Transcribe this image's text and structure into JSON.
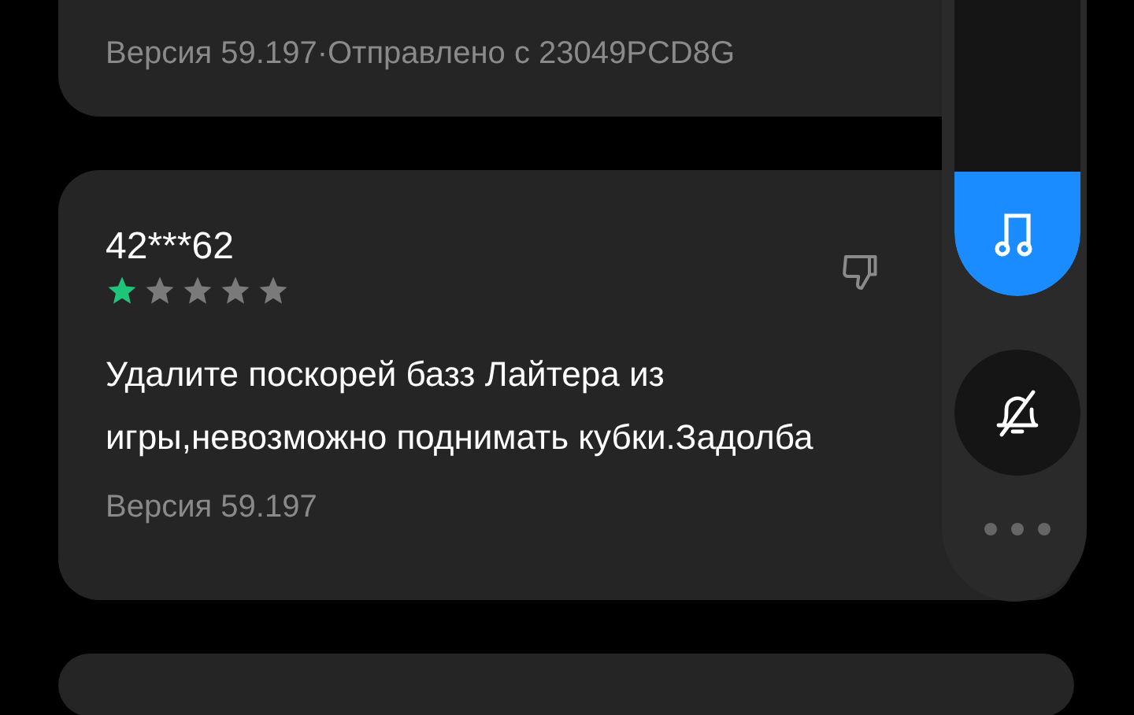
{
  "reviews": [
    {
      "kind": "meta_only",
      "meta": "Версия 59.197·Отправлено с 23049PCD8G"
    },
    {
      "kind": "full",
      "user": "42***62",
      "stars": 1,
      "text": "Удалите поскорей базз Лайтера из игры,невозможно поднимать кубки.Задолба",
      "meta": "Версия 59.197"
    },
    {
      "kind": "partial"
    }
  ],
  "volume_panel": {
    "level": 0.33
  }
}
